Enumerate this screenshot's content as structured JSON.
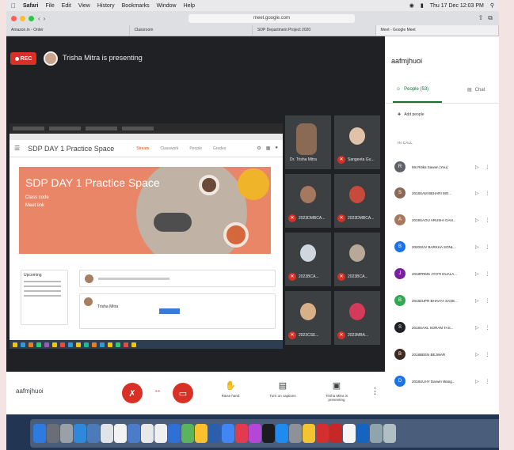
{
  "menubar": {
    "apple": "",
    "app_name": "Safari",
    "menus": [
      "File",
      "Edit",
      "View",
      "History",
      "Bookmarks",
      "Window",
      "Help"
    ],
    "status": "Thu 17 Dec 12:03 PM"
  },
  "browser": {
    "url": "meet.google.com",
    "tabs": [
      "Amazon.in - Order",
      "Classroom",
      "SDP Department Project 2020",
      "Meet - Google Meet"
    ]
  },
  "meet": {
    "rec_label": "REC",
    "presenter_text": "Trisha Mitra is presenting",
    "meeting_code": "aafmjhuoi",
    "controls": {
      "present_label": "Raise hand",
      "captions_label": "Turn on captions",
      "presenting_label": "Trisha Mitra is presenting"
    }
  },
  "shared_screen": {
    "title": "SDP DAY 1 Practice Space",
    "tabs": [
      "Stream",
      "Classwork",
      "People",
      "Grades"
    ],
    "banner_title": "SDP DAY 1 Practice Space",
    "banner_sub1": "Class code",
    "banner_sub2": "Meet link",
    "upcoming_label": "Upcoming",
    "stream_name": "Trisha Mitra"
  },
  "tiles": [
    {
      "name": "Dr. Trisha Mitra",
      "face": "#8a6a55"
    },
    {
      "name": "Sangeeta Gu...",
      "face": "#e0c2a8"
    },
    {
      "name": "2023DMBCA...",
      "face": "#a6785e"
    },
    {
      "name": "2023DMBCA...",
      "face": "#c84a3a"
    },
    {
      "name": "2023BCA...",
      "face": "#cfd6e0"
    },
    {
      "name": "2023BCA...",
      "face": "#b7a898"
    },
    {
      "name": "2023CSE...",
      "face": "#d7b088"
    },
    {
      "name": "2023MBA...",
      "face": "#d43a5a"
    }
  ],
  "panel": {
    "title": "aafmjhuoi",
    "people_tab": "People (53)",
    "chat_tab": "Chat",
    "add_people": "Add people",
    "section": "IN CALL",
    "participants": [
      {
        "name": "Ms Ritika Sawan (You)",
        "color": "#5f6368",
        "initial": "R"
      },
      {
        "name": "2018SAM BEHARI MO...",
        "color": "#8a6a55",
        "initial": "S"
      },
      {
        "name": "2019SAOU ARUSHI GAN...",
        "color": "#a6785e",
        "initial": "A"
      },
      {
        "name": "2020SUV BARKHA SONL...",
        "color": "#1a73e8",
        "initial": "B"
      },
      {
        "name": "2018PRMS JYOTI DUALA...",
        "color": "#7b1fa2",
        "initial": "J"
      },
      {
        "name": "2018ZUPR BHAVYA SAXE...",
        "color": "#33a852",
        "initial": "B"
      },
      {
        "name": "2018SAXL SORAM TAS...",
        "color": "#202124",
        "initial": "S"
      },
      {
        "name": "2018BEEN BEJWAR",
        "color": "#3d2a22",
        "initial": "B"
      },
      {
        "name": "2018UUHY Darwin Wang...",
        "color": "#1a73e8",
        "initial": "D"
      }
    ]
  },
  "colors": {
    "accent_red": "#d93025",
    "accent_green": "#137333",
    "banner": "#e88667"
  }
}
